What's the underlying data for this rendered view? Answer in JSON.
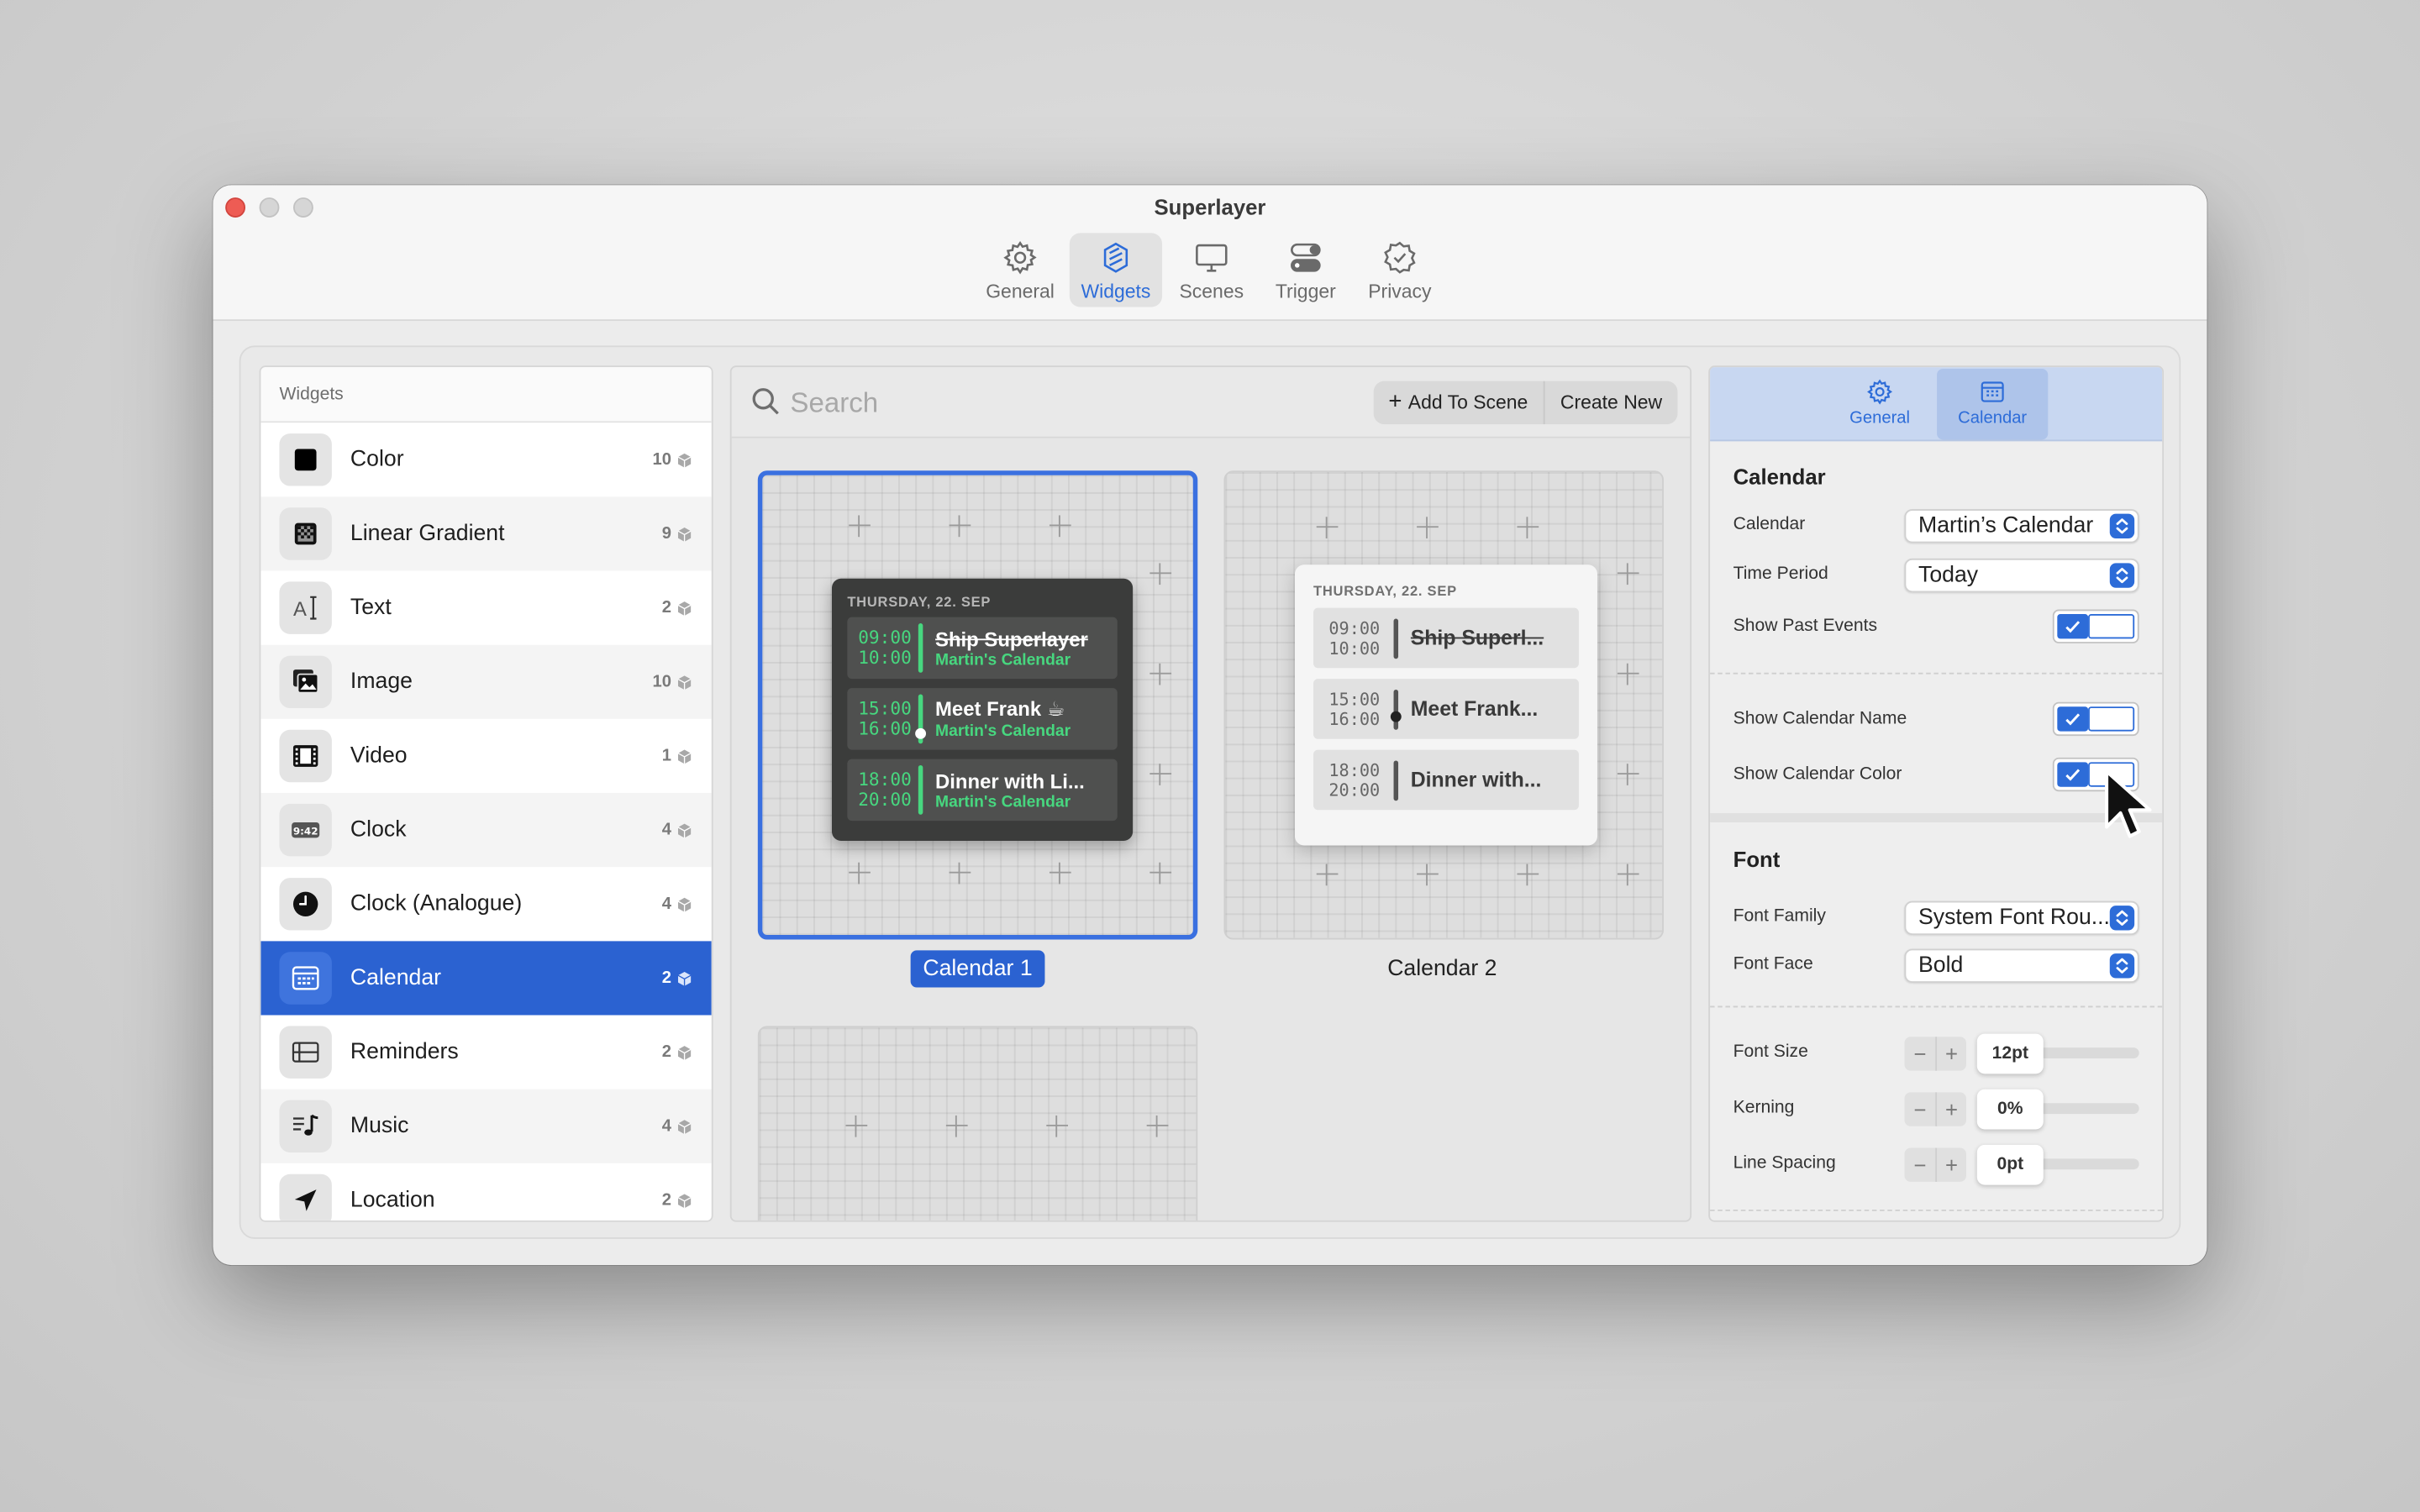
{
  "window": {
    "title": "Superlayer"
  },
  "toolbar": {
    "items": [
      {
        "label": "General",
        "icon": "gear-icon",
        "active": false
      },
      {
        "label": "Widgets",
        "icon": "widgets-icon",
        "active": true
      },
      {
        "label": "Scenes",
        "icon": "monitor-icon",
        "active": false
      },
      {
        "label": "Trigger",
        "icon": "toggles-icon",
        "active": false
      },
      {
        "label": "Privacy",
        "icon": "shield-check-icon",
        "active": false
      }
    ]
  },
  "sidebar": {
    "header": "Widgets",
    "items": [
      {
        "label": "Color",
        "count": "10",
        "icon": "color-square-icon"
      },
      {
        "label": "Linear Gradient",
        "count": "9",
        "icon": "gradient-icon"
      },
      {
        "label": "Text",
        "count": "2",
        "icon": "text-cursor-icon"
      },
      {
        "label": "Image",
        "count": "10",
        "icon": "photo-icon"
      },
      {
        "label": "Video",
        "count": "1",
        "icon": "film-icon"
      },
      {
        "label": "Clock",
        "count": "4",
        "icon": "digital-clock-icon",
        "badge": "9:42"
      },
      {
        "label": "Clock (Analogue)",
        "count": "4",
        "icon": "analog-clock-icon"
      },
      {
        "label": "Calendar",
        "count": "2",
        "icon": "calendar-icon",
        "selected": true
      },
      {
        "label": "Reminders",
        "count": "2",
        "icon": "list-icon"
      },
      {
        "label": "Music",
        "count": "4",
        "icon": "music-note-icon"
      },
      {
        "label": "Location",
        "count": "2",
        "icon": "location-arrow-icon"
      }
    ]
  },
  "middle": {
    "search_placeholder": "Search",
    "add_to_scene": "Add To Scene",
    "create_new": "Create New",
    "cards": [
      {
        "caption": "Calendar 1",
        "selected": true,
        "style": "dark",
        "date": "THURSDAY, 22. SEP",
        "events": [
          {
            "start": "09:00",
            "end": "10:00",
            "title": "Ship Superlayer",
            "calendar": "Martin's Calendar",
            "past": true
          },
          {
            "start": "15:00",
            "end": "16:00",
            "title": "Meet Frank ☕",
            "calendar": "Martin's Calendar",
            "past": false
          },
          {
            "start": "18:00",
            "end": "20:00",
            "title": "Dinner with Li...",
            "calendar": "Martin's Calendar",
            "past": false
          }
        ]
      },
      {
        "caption": "Calendar 2",
        "selected": false,
        "style": "light",
        "date": "THURSDAY, 22. SEP",
        "events": [
          {
            "start": "09:00",
            "end": "10:00",
            "title": "Ship Superl...",
            "past": true
          },
          {
            "start": "15:00",
            "end": "16:00",
            "title": "Meet Frank...",
            "past": false
          },
          {
            "start": "18:00",
            "end": "20:00",
            "title": "Dinner with...",
            "past": false
          }
        ]
      }
    ]
  },
  "inspector": {
    "tabs": [
      {
        "label": "General",
        "icon": "gear-icon",
        "active": false
      },
      {
        "label": "Calendar",
        "icon": "calendar-icon",
        "active": true
      }
    ],
    "calendar_section": {
      "title": "Calendar",
      "calendar_label": "Calendar",
      "calendar_value": "Martin’s Calendar",
      "time_period_label": "Time Period",
      "time_period_value": "Today",
      "show_past_events_label": "Show Past Events",
      "show_calendar_name_label": "Show Calendar Name",
      "show_calendar_color_label": "Show Calendar Color"
    },
    "font_section": {
      "title": "Font",
      "family_label": "Font Family",
      "family_value": "System Font Rou...",
      "face_label": "Font Face",
      "face_value": "Bold",
      "size_label": "Font Size",
      "size_value": "12pt",
      "kerning_label": "Kerning",
      "kerning_value": "0%",
      "spacing_label": "Line Spacing",
      "spacing_value": "0pt"
    }
  },
  "colors": {
    "accent": "#2b62d1",
    "event_green": "#47d77f",
    "close": "#ee5c54"
  }
}
